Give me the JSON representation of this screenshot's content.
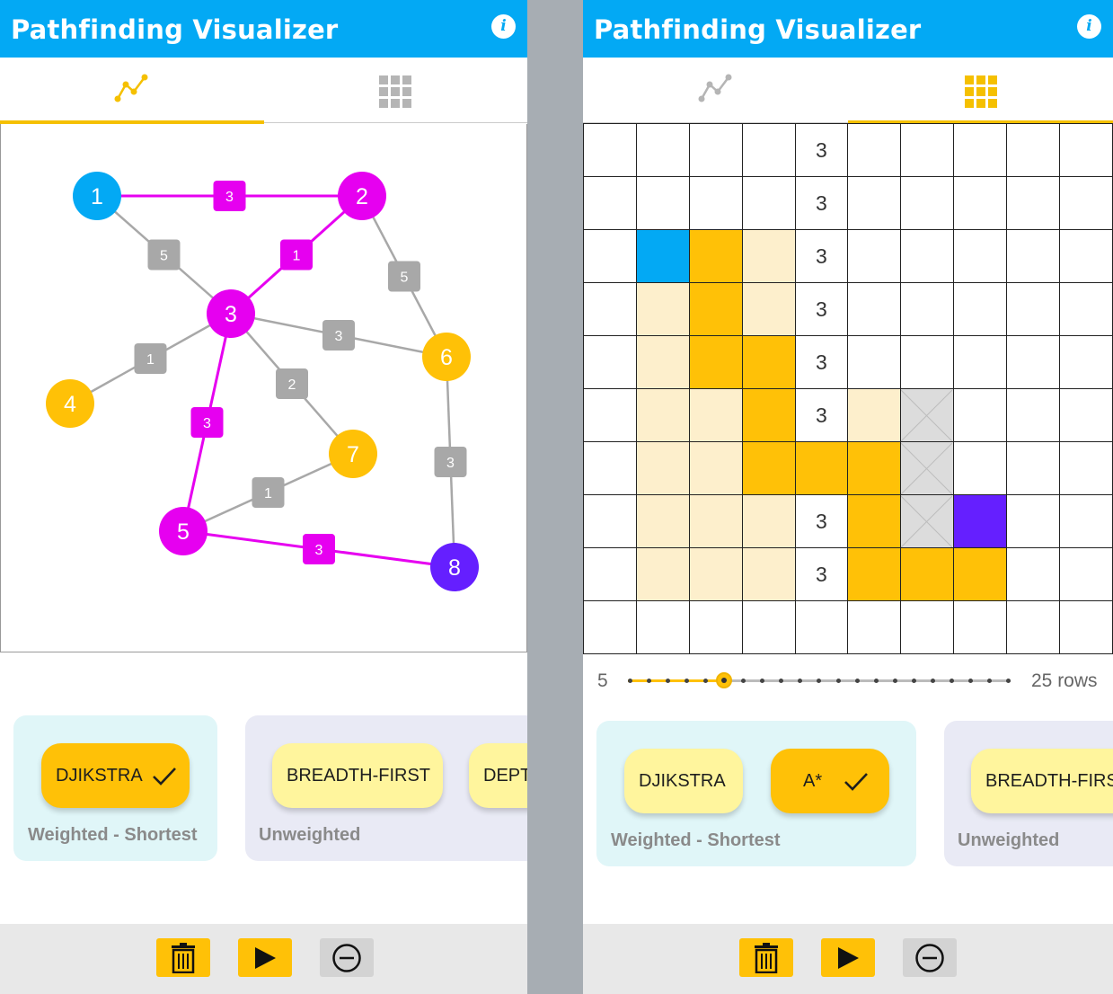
{
  "left": {
    "title": "Pathfinding Visualizer",
    "tabs": [
      {
        "icon": "graph-icon",
        "active": true
      },
      {
        "icon": "grid-icon",
        "active": false
      }
    ],
    "graph": {
      "nodes": [
        {
          "id": "1",
          "state": "start"
        },
        {
          "id": "2",
          "state": "path"
        },
        {
          "id": "3",
          "state": "path"
        },
        {
          "id": "4",
          "state": "visited"
        },
        {
          "id": "5",
          "state": "path"
        },
        {
          "id": "6",
          "state": "visited"
        },
        {
          "id": "7",
          "state": "visited"
        },
        {
          "id": "8",
          "state": "end"
        }
      ],
      "edges": [
        {
          "from": "1",
          "to": "2",
          "weight": "3",
          "on_path": true
        },
        {
          "from": "1",
          "to": "3",
          "weight": "5",
          "on_path": false
        },
        {
          "from": "2",
          "to": "3",
          "weight": "1",
          "on_path": true
        },
        {
          "from": "2",
          "to": "6",
          "weight": "5",
          "on_path": false
        },
        {
          "from": "3",
          "to": "6",
          "weight": "3",
          "on_path": false
        },
        {
          "from": "3",
          "to": "4",
          "weight": "1",
          "on_path": false
        },
        {
          "from": "3",
          "to": "7",
          "weight": "2",
          "on_path": false
        },
        {
          "from": "3",
          "to": "5",
          "weight": "3",
          "on_path": true
        },
        {
          "from": "5",
          "to": "7",
          "weight": "1",
          "on_path": false
        },
        {
          "from": "5",
          "to": "8",
          "weight": "3",
          "on_path": true
        },
        {
          "from": "6",
          "to": "8",
          "weight": "3",
          "on_path": false
        }
      ]
    },
    "algorithms": {
      "weighted": {
        "caption": "Weighted - Shortest",
        "options": [
          {
            "label": "DJIKSTRA",
            "selected": true
          }
        ]
      },
      "unweighted": {
        "caption": "Unweighted",
        "options": [
          {
            "label": "BREADTH-FIRST",
            "selected": false
          },
          {
            "label": "DEPTH-FIRST",
            "selected": false
          }
        ]
      }
    },
    "toolbar": [
      "delete-icon",
      "play-icon",
      "remove-icon"
    ]
  },
  "right": {
    "title": "Pathfinding Visualizer",
    "tabs": [
      {
        "icon": "graph-icon",
        "active": false
      },
      {
        "icon": "grid-icon",
        "active": true
      }
    ],
    "grid": {
      "rows": [
        [
          "",
          "",
          "",
          "",
          "3",
          "",
          "",
          "",
          "",
          ""
        ],
        [
          "",
          "",
          "",
          "",
          "3",
          "",
          "",
          "",
          "",
          ""
        ],
        [
          "",
          "S",
          "P",
          "V",
          "3",
          "",
          "",
          "",
          "",
          ""
        ],
        [
          "",
          "V",
          "P",
          "V",
          "3",
          "",
          "",
          "",
          "",
          ""
        ],
        [
          "",
          "V",
          "P",
          "P",
          "3",
          "",
          "",
          "",
          "",
          ""
        ],
        [
          "",
          "V",
          "V",
          "P",
          "3",
          "V",
          "W",
          "",
          "",
          ""
        ],
        [
          "",
          "V",
          "V",
          "P",
          "P",
          "P",
          "W",
          "",
          "",
          ""
        ],
        [
          "",
          "V",
          "V",
          "V",
          "3",
          "P",
          "W",
          "E",
          "",
          ""
        ],
        [
          "",
          "V",
          "V",
          "V",
          "3",
          "P",
          "P",
          "P",
          "",
          ""
        ],
        [
          "",
          "",
          "",
          "",
          "",
          "",
          "",
          "",
          "",
          ""
        ]
      ],
      "legend": {
        "S": "start",
        "E": "end",
        "P": "path",
        "V": "visited",
        "W": "wall"
      }
    },
    "slider": {
      "min_label": "5",
      "max_label": "25 rows",
      "min": 5,
      "max": 25,
      "value": 10
    },
    "algorithms": {
      "weighted": {
        "caption": "Weighted - Shortest",
        "options": [
          {
            "label": "DJIKSTRA",
            "selected": false
          },
          {
            "label": "A*",
            "selected": true
          }
        ]
      },
      "unweighted": {
        "caption": "Unweighted",
        "options": [
          {
            "label": "BREADTH-FIRST",
            "selected": false
          }
        ]
      }
    },
    "toolbar": [
      "delete-icon",
      "play-icon",
      "remove-icon"
    ]
  },
  "colors": {
    "appbar": "#03a9f4",
    "accent": "#ffc107",
    "path_node": "#e600f0",
    "start": "#03a9f4",
    "end": "#651fff",
    "visited_cell": "#fdefcc",
    "edge": "#a8a8a8"
  }
}
